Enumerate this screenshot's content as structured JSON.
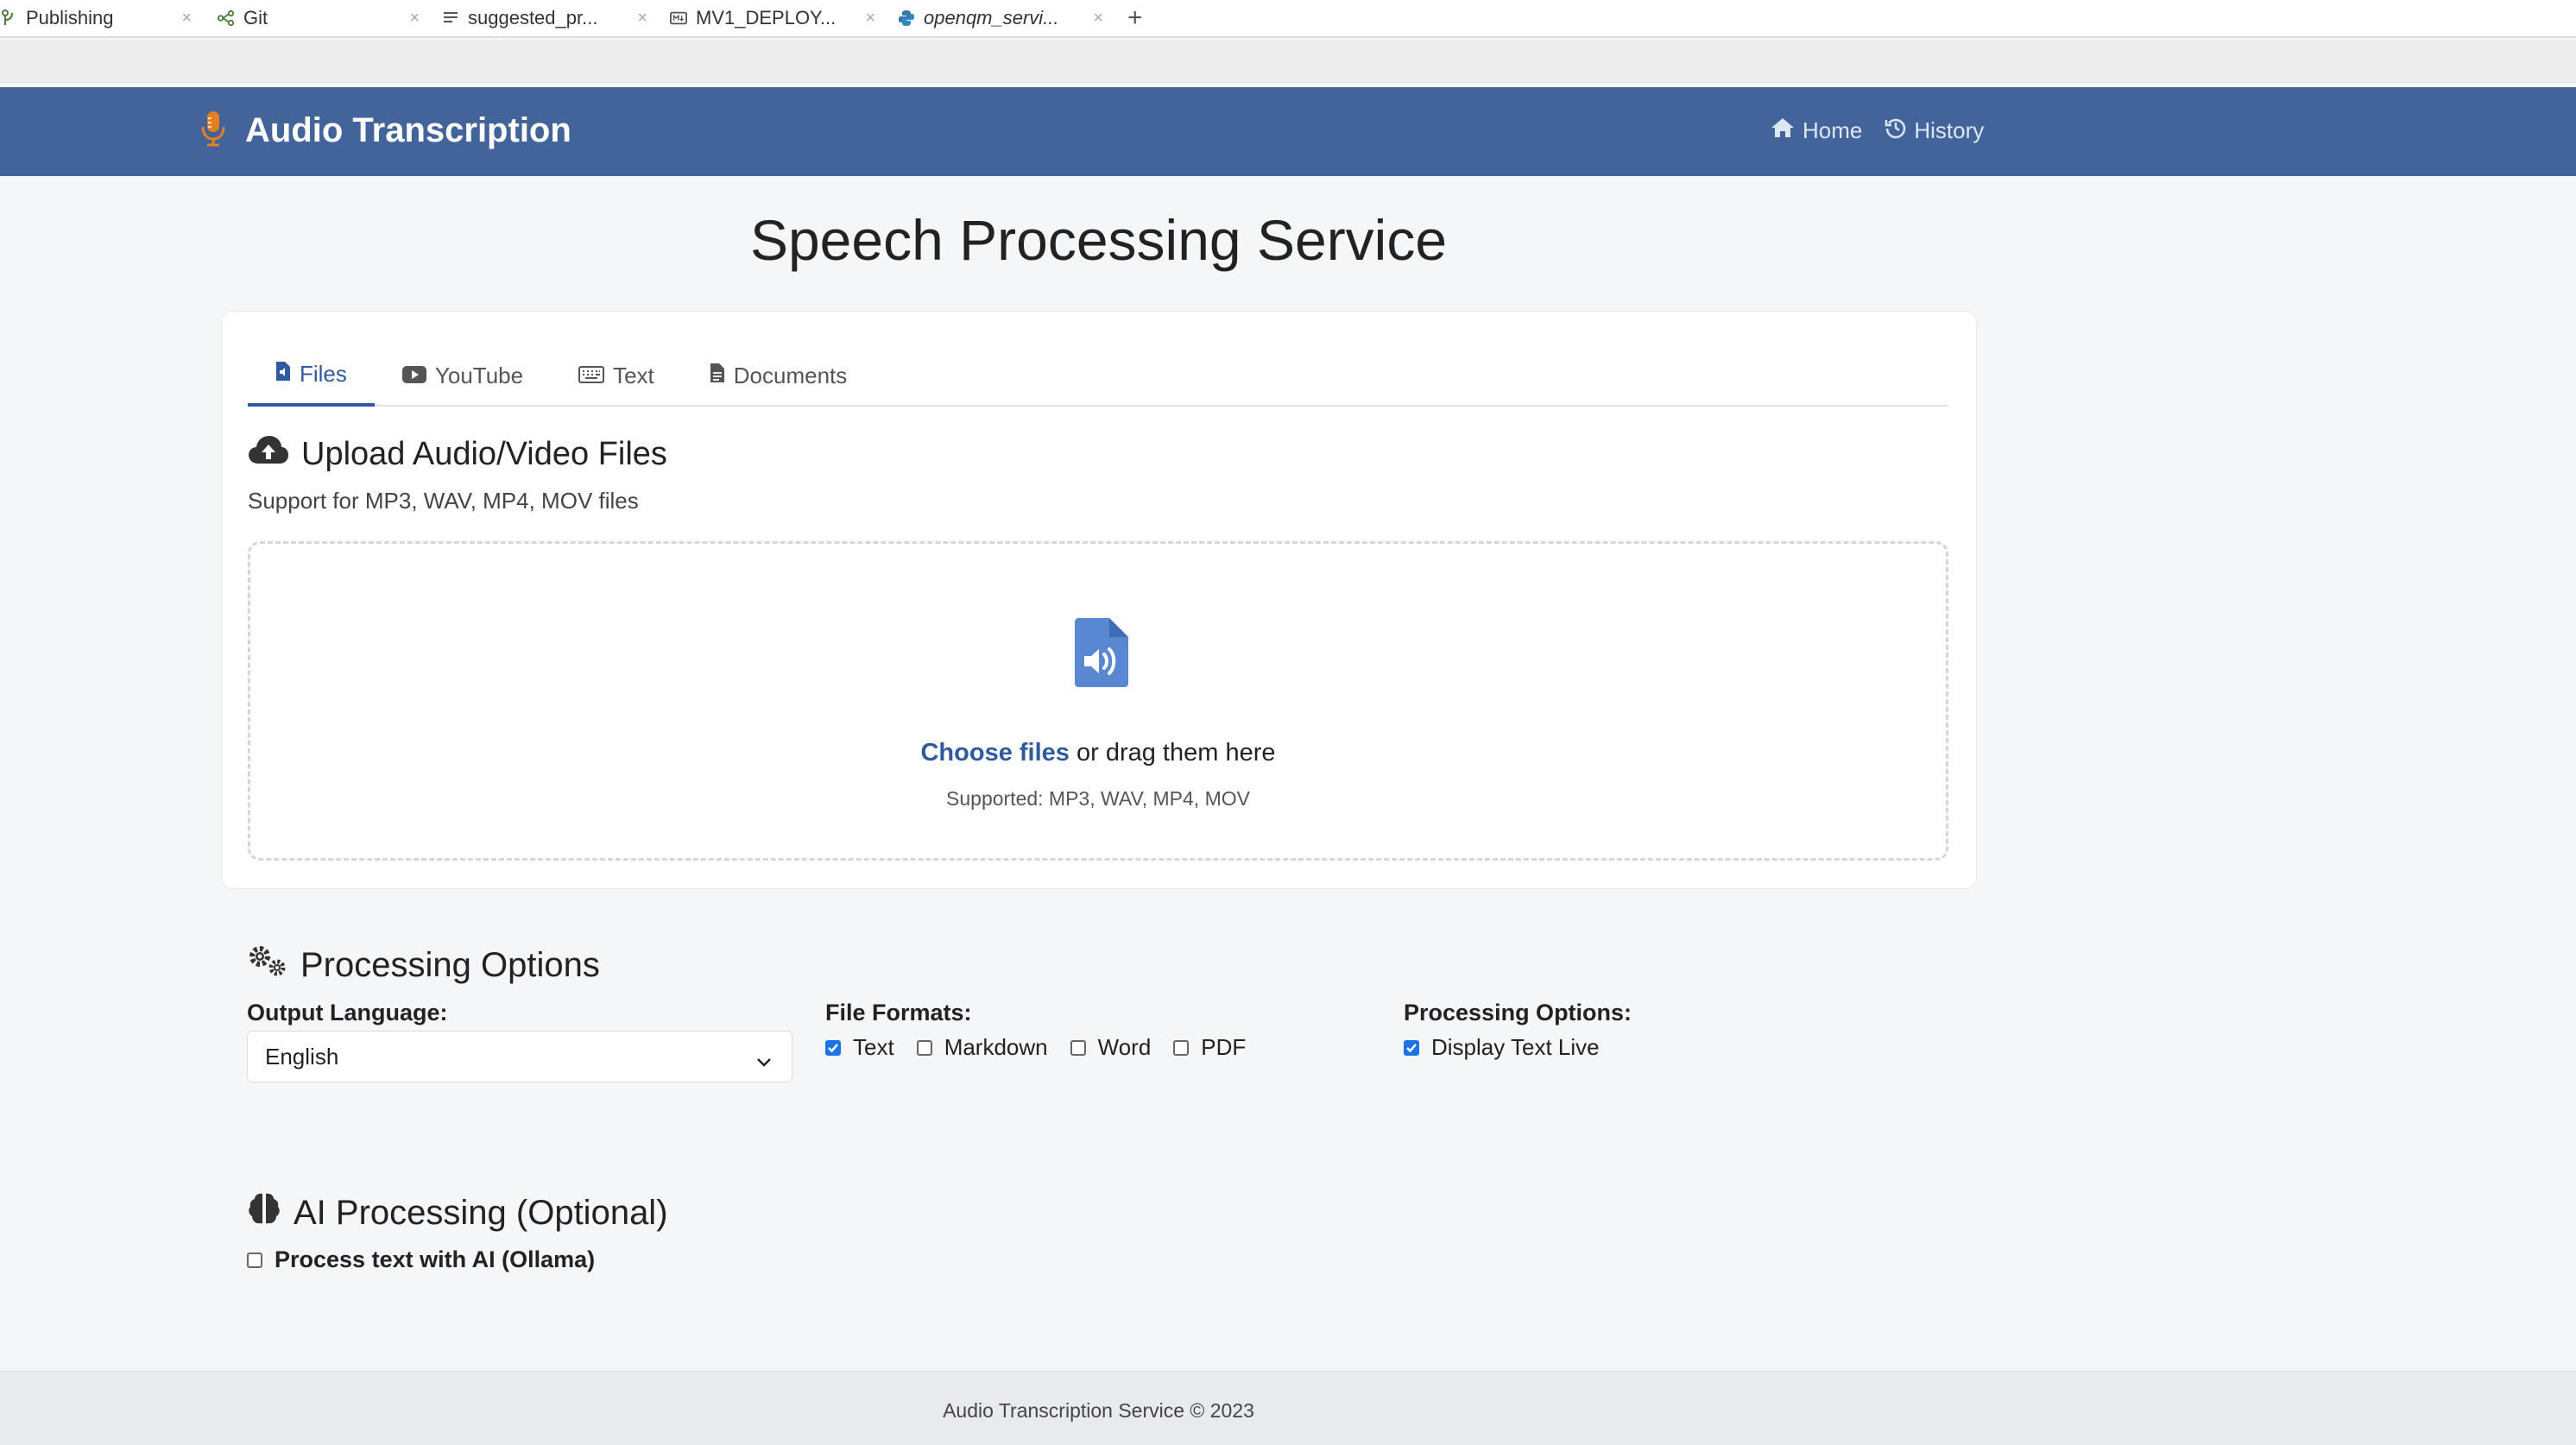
{
  "editor_tabs": [
    {
      "label": "Publishing",
      "icon": "git-branch-icon",
      "italic": false
    },
    {
      "label": "Git",
      "icon": "git-graph-icon",
      "italic": false
    },
    {
      "label": "suggested_pr...",
      "icon": "text-file-icon",
      "italic": false
    },
    {
      "label": "MV1_DEPLOY...",
      "icon": "markdown-icon",
      "italic": false
    },
    {
      "label": "openqm_servi...",
      "icon": "python-icon",
      "italic": true
    }
  ],
  "navbar": {
    "brand": "Audio Transcription",
    "links": [
      {
        "label": "Home",
        "icon": "home-icon"
      },
      {
        "label": "History",
        "icon": "history-icon"
      }
    ],
    "bg_color": "#43649b",
    "accent_color": "#e67e22"
  },
  "page_title": "Speech Processing Service",
  "tabs": [
    {
      "label": "Files",
      "icon": "file-audio-icon",
      "active": true
    },
    {
      "label": "YouTube",
      "icon": "youtube-icon",
      "active": false
    },
    {
      "label": "Text",
      "icon": "keyboard-icon",
      "active": false
    },
    {
      "label": "Documents",
      "icon": "document-icon",
      "active": false
    }
  ],
  "upload": {
    "title": "Upload Audio/Video Files",
    "subtitle": "Support for MP3, WAV, MP4, MOV files",
    "choose_label": "Choose files",
    "drag_text": " or drag them here",
    "supported": "Supported: MP3, WAV, MP4, MOV"
  },
  "processing": {
    "title": "Processing Options",
    "language_label": "Output Language:",
    "language_value": "English",
    "formats_label": "File Formats:",
    "formats": [
      {
        "label": "Text",
        "checked": true
      },
      {
        "label": "Markdown",
        "checked": false
      },
      {
        "label": "Word",
        "checked": false
      },
      {
        "label": "PDF",
        "checked": false
      }
    ],
    "options_label": "Processing Options:",
    "options": [
      {
        "label": "Display Text Live",
        "checked": true
      }
    ]
  },
  "ai": {
    "title": "AI Processing (Optional)",
    "checkbox_label": "Process text with AI (Ollama)",
    "checked": false
  },
  "footer": "Audio Transcription Service © 2023"
}
